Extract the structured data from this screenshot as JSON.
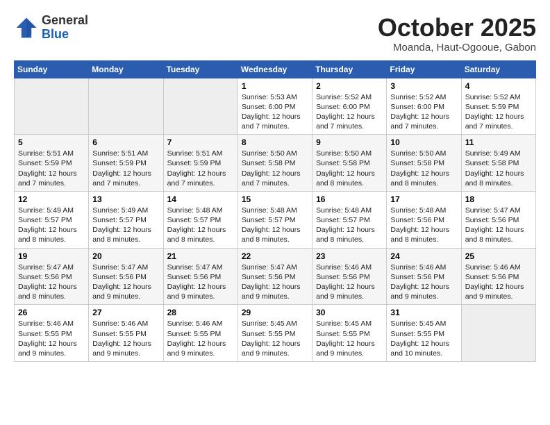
{
  "header": {
    "logo_line1": "General",
    "logo_line2": "Blue",
    "month": "October 2025",
    "location": "Moanda, Haut-Ogooue, Gabon"
  },
  "days_of_week": [
    "Sunday",
    "Monday",
    "Tuesday",
    "Wednesday",
    "Thursday",
    "Friday",
    "Saturday"
  ],
  "weeks": [
    [
      {
        "day": "",
        "empty": true
      },
      {
        "day": "",
        "empty": true
      },
      {
        "day": "",
        "empty": true
      },
      {
        "day": "1",
        "sunrise": "5:53 AM",
        "sunset": "6:00 PM",
        "daylight": "Daylight: 12 hours and 7 minutes."
      },
      {
        "day": "2",
        "sunrise": "5:52 AM",
        "sunset": "6:00 PM",
        "daylight": "Daylight: 12 hours and 7 minutes."
      },
      {
        "day": "3",
        "sunrise": "5:52 AM",
        "sunset": "6:00 PM",
        "daylight": "Daylight: 12 hours and 7 minutes."
      },
      {
        "day": "4",
        "sunrise": "5:52 AM",
        "sunset": "5:59 PM",
        "daylight": "Daylight: 12 hours and 7 minutes."
      }
    ],
    [
      {
        "day": "5",
        "sunrise": "5:51 AM",
        "sunset": "5:59 PM",
        "daylight": "Daylight: 12 hours and 7 minutes."
      },
      {
        "day": "6",
        "sunrise": "5:51 AM",
        "sunset": "5:59 PM",
        "daylight": "Daylight: 12 hours and 7 minutes."
      },
      {
        "day": "7",
        "sunrise": "5:51 AM",
        "sunset": "5:59 PM",
        "daylight": "Daylight: 12 hours and 7 minutes."
      },
      {
        "day": "8",
        "sunrise": "5:50 AM",
        "sunset": "5:58 PM",
        "daylight": "Daylight: 12 hours and 7 minutes."
      },
      {
        "day": "9",
        "sunrise": "5:50 AM",
        "sunset": "5:58 PM",
        "daylight": "Daylight: 12 hours and 8 minutes."
      },
      {
        "day": "10",
        "sunrise": "5:50 AM",
        "sunset": "5:58 PM",
        "daylight": "Daylight: 12 hours and 8 minutes."
      },
      {
        "day": "11",
        "sunrise": "5:49 AM",
        "sunset": "5:58 PM",
        "daylight": "Daylight: 12 hours and 8 minutes."
      }
    ],
    [
      {
        "day": "12",
        "sunrise": "5:49 AM",
        "sunset": "5:57 PM",
        "daylight": "Daylight: 12 hours and 8 minutes."
      },
      {
        "day": "13",
        "sunrise": "5:49 AM",
        "sunset": "5:57 PM",
        "daylight": "Daylight: 12 hours and 8 minutes."
      },
      {
        "day": "14",
        "sunrise": "5:48 AM",
        "sunset": "5:57 PM",
        "daylight": "Daylight: 12 hours and 8 minutes."
      },
      {
        "day": "15",
        "sunrise": "5:48 AM",
        "sunset": "5:57 PM",
        "daylight": "Daylight: 12 hours and 8 minutes."
      },
      {
        "day": "16",
        "sunrise": "5:48 AM",
        "sunset": "5:57 PM",
        "daylight": "Daylight: 12 hours and 8 minutes."
      },
      {
        "day": "17",
        "sunrise": "5:48 AM",
        "sunset": "5:56 PM",
        "daylight": "Daylight: 12 hours and 8 minutes."
      },
      {
        "day": "18",
        "sunrise": "5:47 AM",
        "sunset": "5:56 PM",
        "daylight": "Daylight: 12 hours and 8 minutes."
      }
    ],
    [
      {
        "day": "19",
        "sunrise": "5:47 AM",
        "sunset": "5:56 PM",
        "daylight": "Daylight: 12 hours and 8 minutes."
      },
      {
        "day": "20",
        "sunrise": "5:47 AM",
        "sunset": "5:56 PM",
        "daylight": "Daylight: 12 hours and 9 minutes."
      },
      {
        "day": "21",
        "sunrise": "5:47 AM",
        "sunset": "5:56 PM",
        "daylight": "Daylight: 12 hours and 9 minutes."
      },
      {
        "day": "22",
        "sunrise": "5:47 AM",
        "sunset": "5:56 PM",
        "daylight": "Daylight: 12 hours and 9 minutes."
      },
      {
        "day": "23",
        "sunrise": "5:46 AM",
        "sunset": "5:56 PM",
        "daylight": "Daylight: 12 hours and 9 minutes."
      },
      {
        "day": "24",
        "sunrise": "5:46 AM",
        "sunset": "5:56 PM",
        "daylight": "Daylight: 12 hours and 9 minutes."
      },
      {
        "day": "25",
        "sunrise": "5:46 AM",
        "sunset": "5:56 PM",
        "daylight": "Daylight: 12 hours and 9 minutes."
      }
    ],
    [
      {
        "day": "26",
        "sunrise": "5:46 AM",
        "sunset": "5:55 PM",
        "daylight": "Daylight: 12 hours and 9 minutes."
      },
      {
        "day": "27",
        "sunrise": "5:46 AM",
        "sunset": "5:55 PM",
        "daylight": "Daylight: 12 hours and 9 minutes."
      },
      {
        "day": "28",
        "sunrise": "5:46 AM",
        "sunset": "5:55 PM",
        "daylight": "Daylight: 12 hours and 9 minutes."
      },
      {
        "day": "29",
        "sunrise": "5:45 AM",
        "sunset": "5:55 PM",
        "daylight": "Daylight: 12 hours and 9 minutes."
      },
      {
        "day": "30",
        "sunrise": "5:45 AM",
        "sunset": "5:55 PM",
        "daylight": "Daylight: 12 hours and 9 minutes."
      },
      {
        "day": "31",
        "sunrise": "5:45 AM",
        "sunset": "5:55 PM",
        "daylight": "Daylight: 12 hours and 10 minutes."
      },
      {
        "day": "",
        "empty": true
      }
    ]
  ]
}
